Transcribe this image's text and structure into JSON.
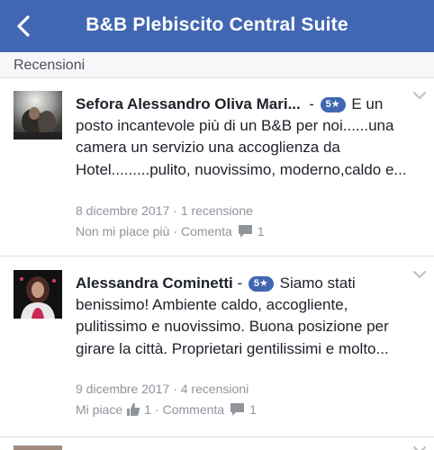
{
  "header": {
    "back_icon": "chevron-left-icon",
    "title": "B&B Plebiscito Central Suite",
    "background": "#4267b2"
  },
  "section": {
    "title": "Recensioni"
  },
  "reviews": [
    {
      "author": "Sefora Alessandro Oliva Mari...",
      "dash": "-",
      "rating": "5★",
      "text": "E un posto incantevole più di un B&B per noi......una camera un servizio una accoglienza da Hotel.........pulito, nuovissimo, moderno,caldo e...",
      "date": "8 dicembre 2017 · 1 recensione",
      "like_label": "Non mi piace più",
      "like_count": "",
      "comment_label": "Comenta",
      "comment_count": "1"
    },
    {
      "author": "Alessandra Cominetti",
      "dash": "-",
      "rating": "5★",
      "text": "Siamo stati benissimo! Ambiente caldo, accogliente, pulitissimo e nuovissimo. Buona posizione per girare la città. Proprietari gentilissimi e molto...",
      "date": "9 dicembre 2017 · 4 recensioni",
      "like_label": "Mi piace",
      "like_count": "1",
      "comment_label": "Commenta",
      "comment_count": "1"
    }
  ],
  "colors": {
    "accent": "#4267b2",
    "muted": "#90949c",
    "text": "#1d2129"
  }
}
